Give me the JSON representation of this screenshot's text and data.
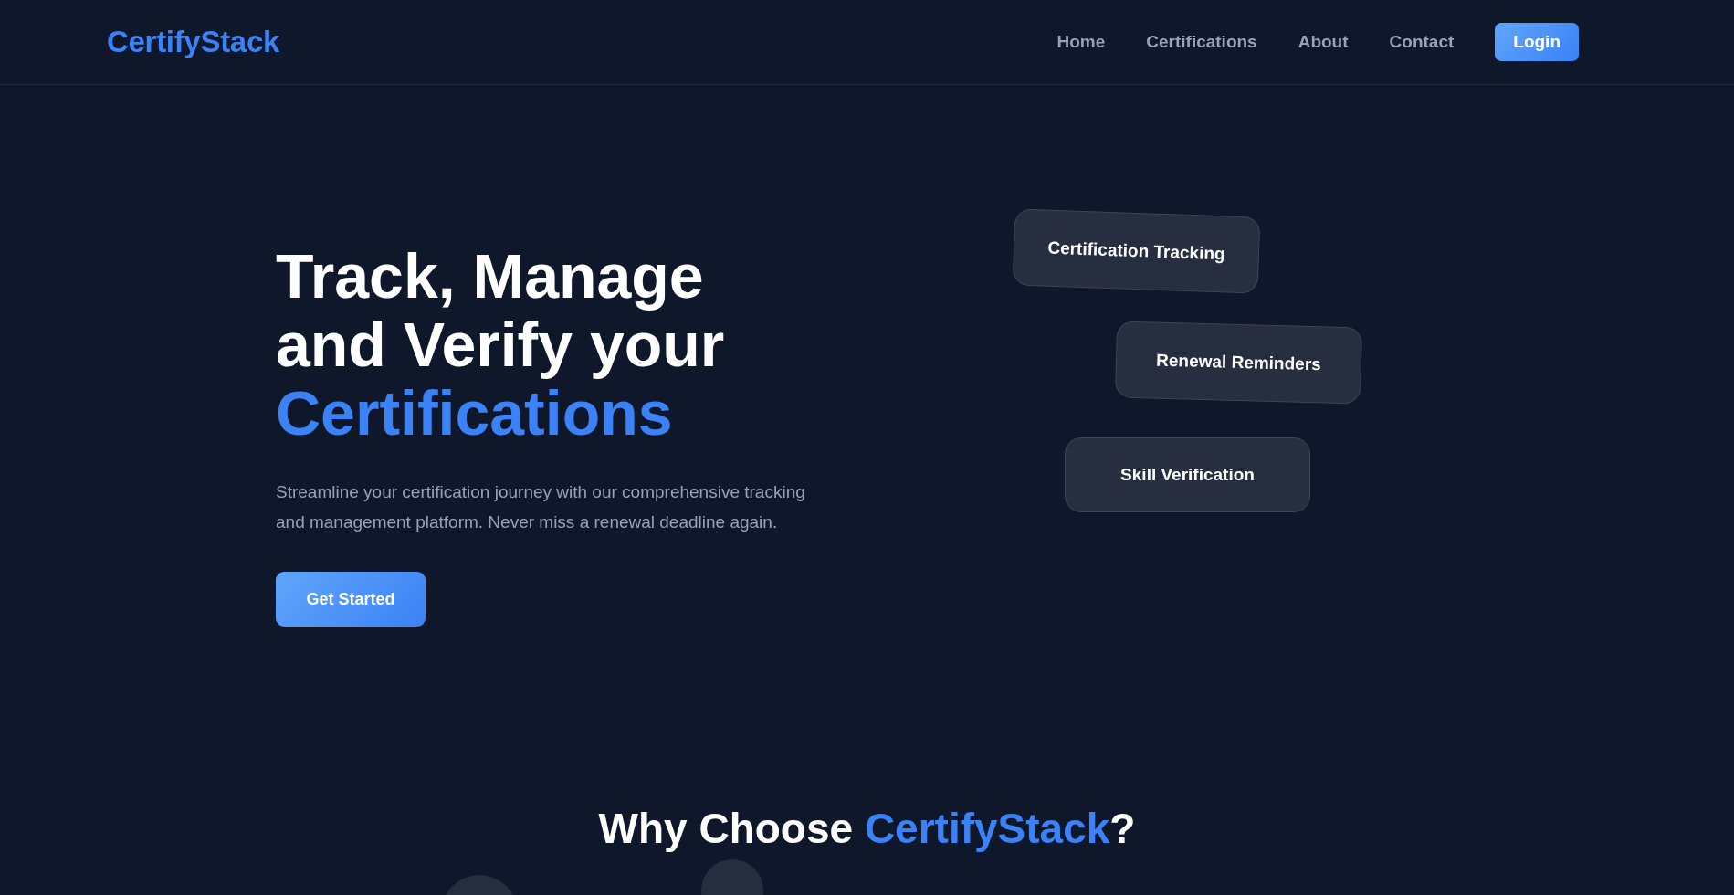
{
  "header": {
    "logo": "CertifyStack",
    "nav": [
      {
        "label": "Home"
      },
      {
        "label": "Certifications"
      },
      {
        "label": "About"
      },
      {
        "label": "Contact"
      }
    ],
    "login": "Login"
  },
  "hero": {
    "title": [
      {
        "text": "Track, Manage",
        "accent": false
      },
      {
        "text": "and Verify your",
        "accent": false
      },
      {
        "text": "Certifications",
        "accent": true
      }
    ],
    "description": "Streamline your certification journey with our comprehensive tracking and management platform. Never miss a renewal deadline again.",
    "cta": "Get Started",
    "cards": [
      {
        "label": "Certification Tracking"
      },
      {
        "label": "Renewal Reminders"
      },
      {
        "label": "Skill Verification"
      }
    ]
  },
  "features": {
    "heading": [
      {
        "text": "Why Choose ",
        "accent": false
      },
      {
        "text": "CertifyStack",
        "accent": true
      },
      {
        "text": "?",
        "accent": false
      }
    ]
  }
}
